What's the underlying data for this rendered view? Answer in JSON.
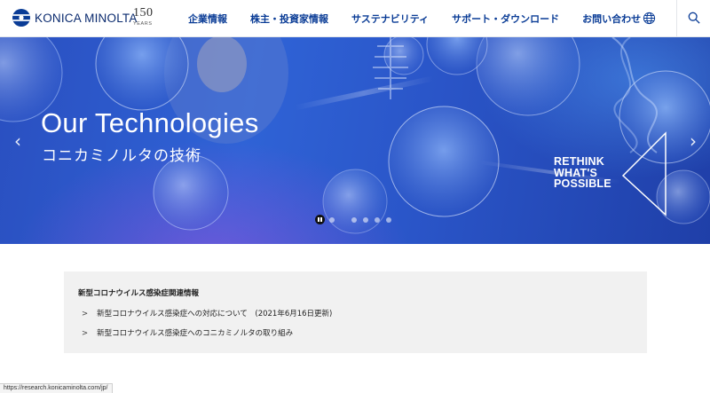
{
  "header": {
    "logo_text": "KONICA MINOLTA",
    "anniversary_number": "150",
    "anniversary_label": "YEARS",
    "nav": [
      {
        "label": "企業情報"
      },
      {
        "label": "株主・投資家情報"
      },
      {
        "label": "サステナビリティ"
      },
      {
        "label": "サポート・ダウンロード"
      },
      {
        "label": "お問い合わせ"
      }
    ],
    "icons": {
      "language": "globe-icon",
      "search": "search-icon"
    }
  },
  "hero": {
    "title": "Our Technologies",
    "subtitle": "コニカミノルタの技術",
    "tagline": [
      "RETHINK",
      "WHAT'S",
      "POSSIBLE"
    ],
    "prev_arrow": "‹",
    "next_arrow": "›",
    "carousel": {
      "slide_count": 6,
      "active_index": 0,
      "state": "playing"
    },
    "colors": {
      "accent": "#0a3c96",
      "hero_blue": "#2f63d6"
    }
  },
  "notice": {
    "title": "新型コロナウイルス感染症関連情報",
    "links": [
      {
        "marker": ">",
        "text": "新型コロナウイルス感染症への対応について　(2021年6月16日更新)"
      },
      {
        "marker": ">",
        "text": "新型コロナウイルス感染症へのコニカミノルタの取り組み"
      }
    ]
  },
  "status_bar": {
    "url": "https://research.konicaminolta.com/jp/"
  }
}
